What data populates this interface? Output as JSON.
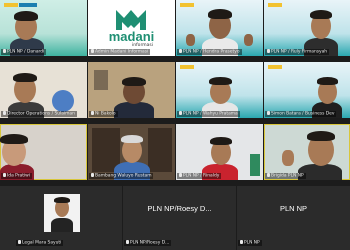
{
  "tiles": [
    {
      "label": "PLN NP / Danardi"
    },
    {
      "label": "Admin Madani Informasi",
      "logo_word": "madani",
      "logo_sub": "informasi"
    },
    {
      "label": "PLN NP / Hendra Prasetyo"
    },
    {
      "label": "PLN NP / Ruly Firmansyah"
    },
    {
      "label": "Director Operations / Sulaiman"
    },
    {
      "label": "Ni Bakolo"
    },
    {
      "label": "PLN NP / Wahyu Pratama"
    },
    {
      "label": "Simon Batara / Business Dev"
    },
    {
      "label": "Ida Pratiwi"
    },
    {
      "label": "Bambang Waluyo Rustam"
    },
    {
      "label": "PLN NP / Rinaldy"
    },
    {
      "label": "Brigida PLN NP"
    },
    {
      "label": "Legal Mara Sayuti"
    },
    {
      "label": "PLN NP/Roesy D...",
      "big": "PLN NP/Roesy D..."
    },
    {
      "label": "PLN NP",
      "big": "PLN NP"
    }
  ],
  "colors": {
    "accent": "#d8c63a",
    "madani_green": "#1f8f73",
    "pln_blue": "#1b7fb0"
  }
}
